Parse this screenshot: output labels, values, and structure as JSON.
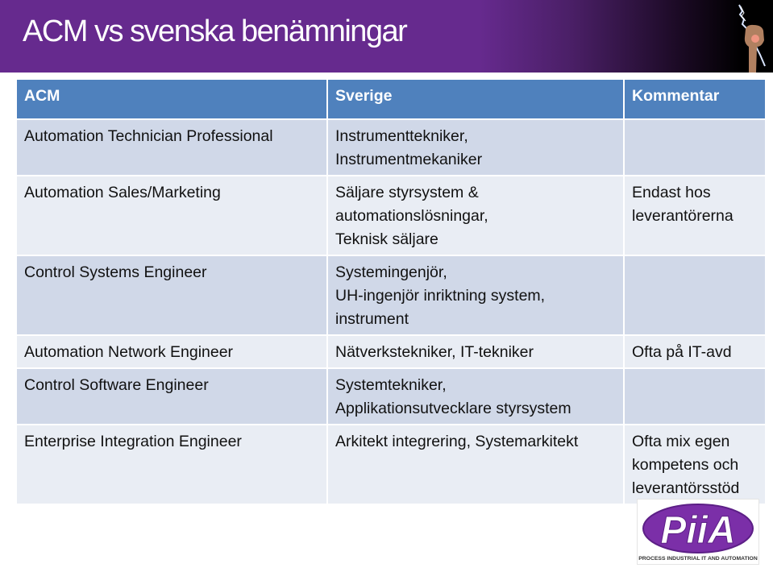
{
  "slide": {
    "title": "ACM vs svenska benämningar",
    "colors": {
      "title_bar": "#662a8e",
      "header": "#4f81bd",
      "row_odd": "#d0d8e8",
      "row_even": "#e9edf4"
    }
  },
  "table": {
    "headers": [
      "ACM",
      "Sverige",
      "Kommentar"
    ],
    "rows": [
      {
        "acm": [
          "Automation Technician Professional"
        ],
        "sverige": [
          "Instrumenttekniker,",
          "Instrumentmekaniker"
        ],
        "kommentar": []
      },
      {
        "acm": [
          "Automation Sales/Marketing"
        ],
        "sverige": [
          "Säljare styrsystem &",
          "automationslösningar,",
          "Teknisk säljare"
        ],
        "kommentar": [
          "Endast hos",
          "leverantörerna"
        ]
      },
      {
        "acm": [
          "Control Systems Engineer"
        ],
        "sverige": [
          "Systemingenjör,",
          "UH-ingenjör inriktning system,",
          "instrument"
        ],
        "kommentar": []
      },
      {
        "acm": [
          "Automation Network Engineer"
        ],
        "sverige": [
          "Nätverkstekniker, IT-tekniker"
        ],
        "kommentar": [
          "Ofta på IT-avd"
        ]
      },
      {
        "acm": [
          "Control Software Engineer"
        ],
        "sverige": [
          "Systemtekniker,",
          "Applikationsutvecklare styrsystem"
        ],
        "kommentar": []
      },
      {
        "acm": [
          "Enterprise Integration Engineer"
        ],
        "sverige": [
          "Arkitekt integrering, Systemarkitekt"
        ],
        "kommentar": [
          "Ofta mix egen",
          "kompetens och",
          "leverantörsstöd"
        ]
      }
    ]
  },
  "logo": {
    "letters": "PiiA",
    "tagline": "PROCESS INDUSTRIAL IT AND AUTOMATION",
    "color": "#7b2fa8"
  },
  "icons": {
    "title_image": "raised-fist-lightning-icon"
  }
}
